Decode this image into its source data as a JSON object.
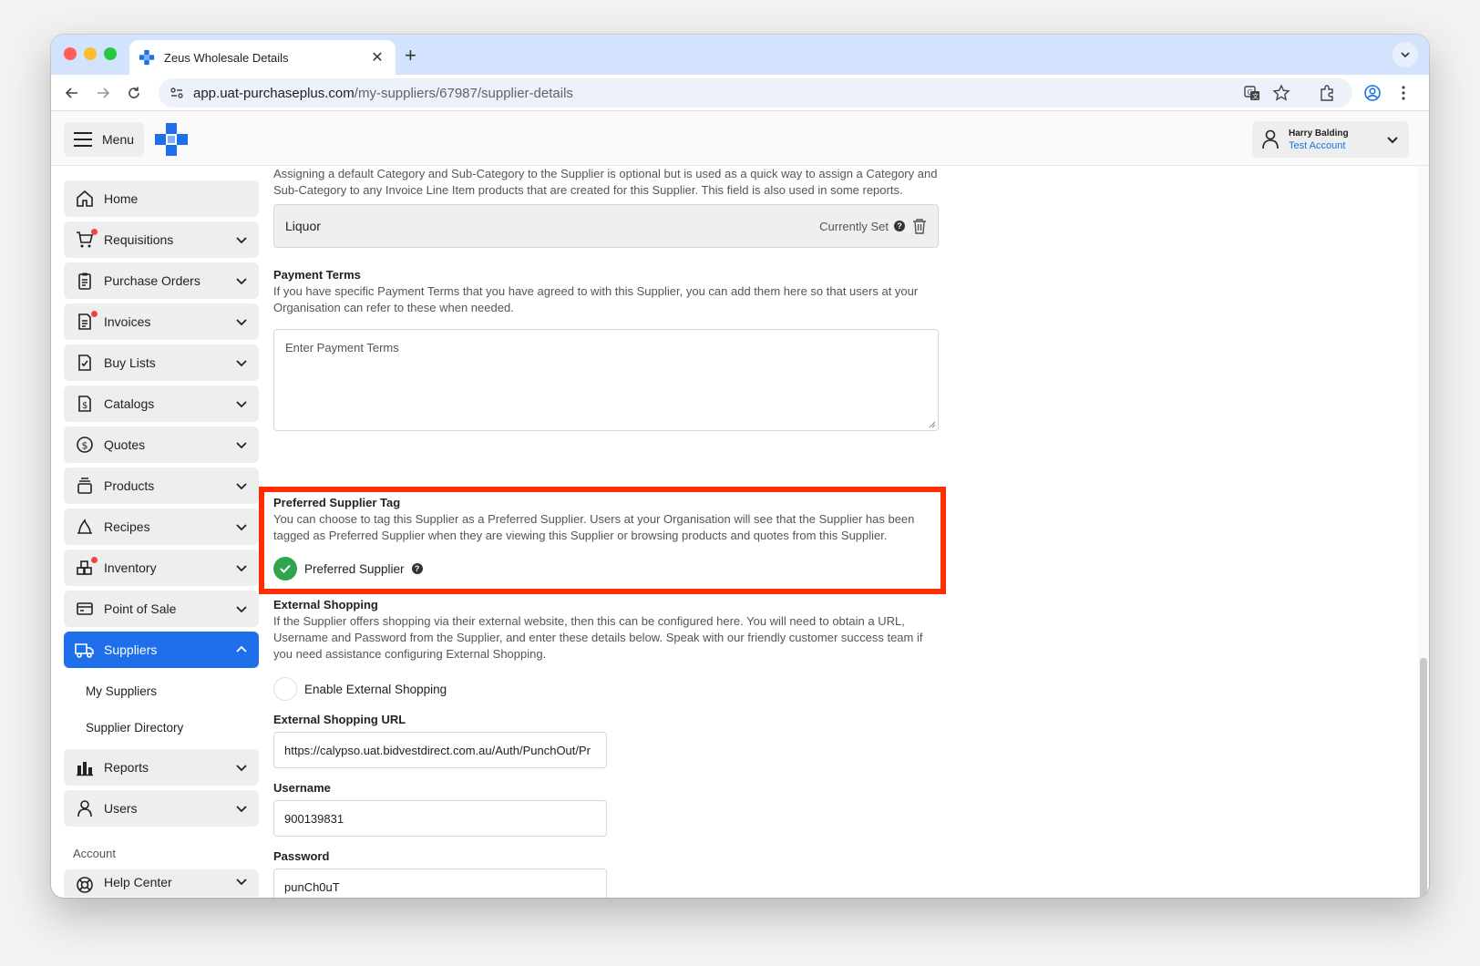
{
  "browser": {
    "tab_title": "Zeus Wholesale Details",
    "url_host": "app.uat-purchaseplus.com",
    "url_path": "/my-suppliers/67987/supplier-details"
  },
  "header": {
    "menu_label": "Menu",
    "user_name": "Harry Balding",
    "user_account": "Test Account"
  },
  "sidebar": {
    "items": [
      {
        "label": "Home",
        "icon": "home-icon",
        "chevron": false,
        "dot": false
      },
      {
        "label": "Requisitions",
        "icon": "cart-icon",
        "chevron": true,
        "dot": true
      },
      {
        "label": "Purchase Orders",
        "icon": "clipboard-icon",
        "chevron": true,
        "dot": false
      },
      {
        "label": "Invoices",
        "icon": "invoice-icon",
        "chevron": true,
        "dot": true
      },
      {
        "label": "Buy Lists",
        "icon": "checklist-icon",
        "chevron": true,
        "dot": false
      },
      {
        "label": "Catalogs",
        "icon": "catalog-icon",
        "chevron": true,
        "dot": false
      },
      {
        "label": "Quotes",
        "icon": "dollar-icon",
        "chevron": true,
        "dot": false
      },
      {
        "label": "Products",
        "icon": "products-icon",
        "chevron": true,
        "dot": false
      },
      {
        "label": "Recipes",
        "icon": "recipes-icon",
        "chevron": true,
        "dot": false
      },
      {
        "label": "Inventory",
        "icon": "inventory-icon",
        "chevron": true,
        "dot": true
      },
      {
        "label": "Point of Sale",
        "icon": "pos-icon",
        "chevron": true,
        "dot": false
      },
      {
        "label": "Suppliers",
        "icon": "truck-icon",
        "chevron": true,
        "dot": false,
        "active": true
      }
    ],
    "sub_items": [
      "My Suppliers",
      "Supplier Directory"
    ],
    "items_after": [
      {
        "label": "Reports",
        "icon": "reports-icon"
      },
      {
        "label": "Users",
        "icon": "user-icon"
      }
    ],
    "account_label": "Account",
    "help_center": "Help Center"
  },
  "main": {
    "category_desc": "Assigning a default Category and Sub-Category to the Supplier is optional but is used as a quick way to assign a Category and Sub-Category to any Invoice Line Item products that are created for this Supplier. This field is also used in some reports.",
    "category_value": "Liquor",
    "currently_set": "Currently Set",
    "payment_terms_heading": "Payment Terms",
    "payment_terms_desc": "If you have specific Payment Terms that you have agreed to with this Supplier, you can add them here so that users at your Organisation can refer to these when needed.",
    "payment_terms_placeholder": "Enter Payment Terms",
    "preferred_heading": "Preferred Supplier Tag",
    "preferred_desc": "You can choose to tag this Supplier as a Preferred Supplier. Users at your Organisation will see that the Supplier has been tagged as Preferred Supplier when they are viewing this Supplier or browsing products and quotes from this Supplier.",
    "preferred_label": "Preferred Supplier",
    "external_heading": "External Shopping",
    "external_desc": "If the Supplier offers shopping via their external website, then this can be configured here. You will need to obtain a URL, Username and Password from the Supplier, and enter these details below. Speak with our friendly customer success team if you need assistance configuring External Shopping.",
    "enable_external_label": "Enable External Shopping",
    "url_heading": "External Shopping URL",
    "url_value": "https://calypso.uat.bidvestdirect.com.au/Auth/PunchOut/Pr",
    "username_heading": "Username",
    "username_value": "900139831",
    "password_heading": "Password",
    "password_value": "punCh0uT"
  },
  "colors": {
    "accent": "#1f6feb",
    "highlight_border": "#ff2d00",
    "checked": "#2ea44f"
  }
}
